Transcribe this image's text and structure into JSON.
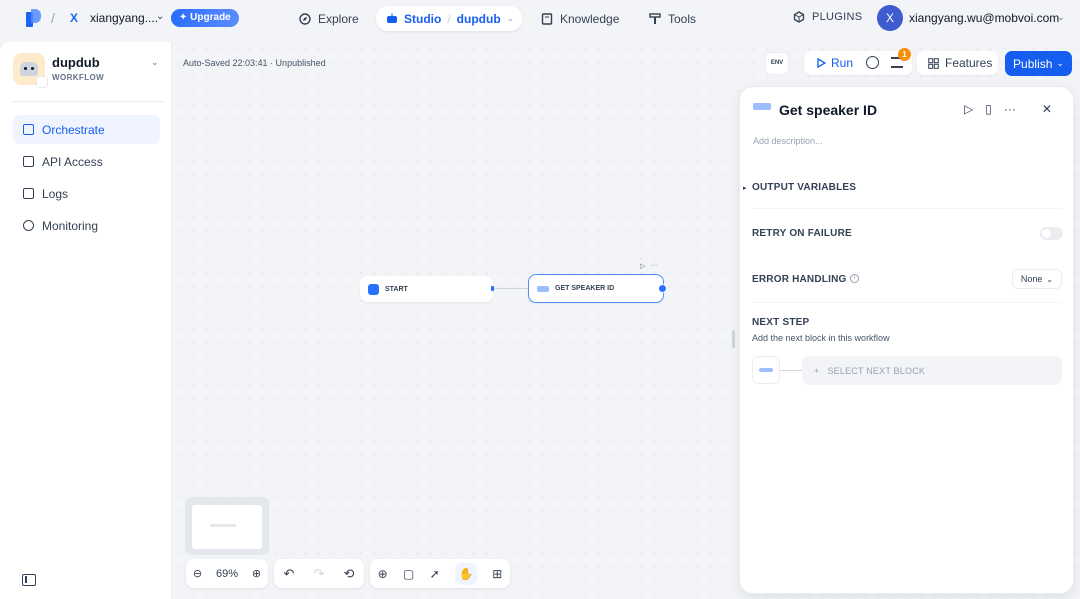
{
  "topbar": {
    "workspace_initial": "X",
    "workspace_name": "xiangyang....",
    "upgrade_label": "Upgrade",
    "nav": {
      "explore": "Explore",
      "studio": "Studio",
      "app": "dupdub",
      "knowledge": "Knowledge",
      "tools": "Tools"
    },
    "plugins": "PLUGINS",
    "user_initial": "X",
    "user_email": "xiangyang.wu@mobvoi.com"
  },
  "sidebar": {
    "app_name": "dupdub",
    "app_type": "WORKFLOW",
    "items": [
      {
        "label": "Orchestrate",
        "icon": "orchestrate-icon",
        "active": true
      },
      {
        "label": "API Access",
        "icon": "api-terminal-icon",
        "active": false
      },
      {
        "label": "Logs",
        "icon": "logs-icon",
        "active": false
      },
      {
        "label": "Monitoring",
        "icon": "monitoring-icon",
        "active": false
      }
    ]
  },
  "canvas": {
    "autosave": "Auto-Saved 22:03:41 · Unpublished",
    "env": "ENV",
    "run": "Run",
    "pending_count": "1",
    "features": "Features",
    "publish": "Publish",
    "nodes": {
      "start": "START",
      "get_speaker": "GET SPEAKER ID"
    },
    "zoom": "69%"
  },
  "panel": {
    "title": "Get speaker ID",
    "description_placeholder": "Add description...",
    "output_variables": "OUTPUT VARIABLES",
    "retry_on_failure": "RETRY ON FAILURE",
    "error_handling": "ERROR HANDLING",
    "error_handling_value": "None",
    "next_step": "NEXT STEP",
    "next_step_sub": "Add the next block in this workflow",
    "select_next_block": "SELECT NEXT BLOCK"
  },
  "colors": {
    "accent": "#155eef",
    "badge": "#f79009"
  }
}
